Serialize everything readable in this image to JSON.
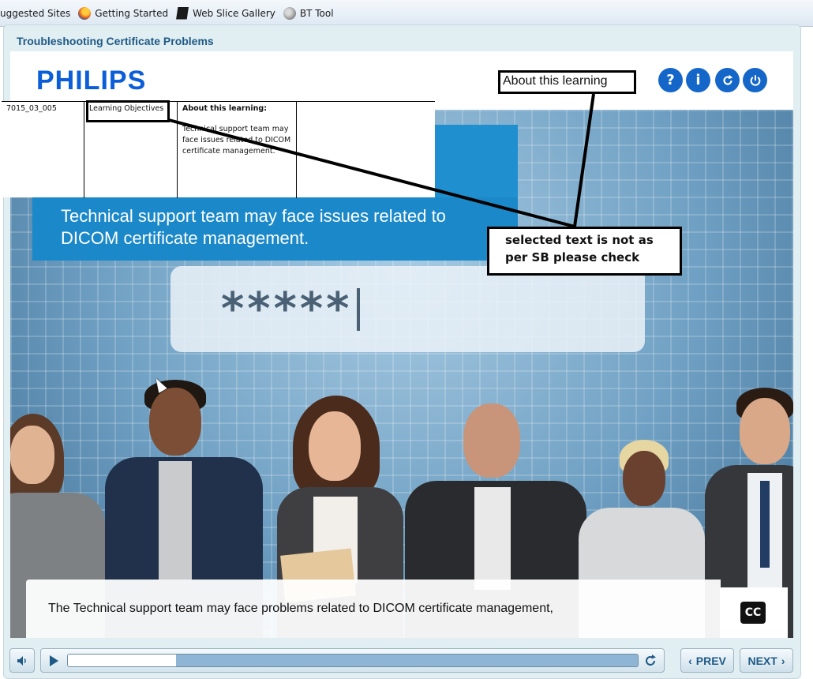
{
  "favorites_bar": {
    "items": [
      {
        "label": "uggested Sites",
        "icon": "ie-icon"
      },
      {
        "label": "Getting Started",
        "icon": "firefox-icon"
      },
      {
        "label": "Web Slice Gallery",
        "icon": "web-slice-icon"
      },
      {
        "label": "BT Tool",
        "icon": "globe-icon"
      }
    ]
  },
  "course": {
    "title": "Troubleshooting Certificate Problems",
    "logo": "PHILIPS",
    "header_buttons": [
      {
        "label": "?",
        "icon": "help-icon"
      },
      {
        "label": "i",
        "icon": "info-icon"
      },
      {
        "icon": "refresh-icon"
      },
      {
        "icon": "power-icon"
      }
    ]
  },
  "slide": {
    "banner_text": "Technical support team may face issues related to DICOM certificate management.",
    "password_text": "*****",
    "caption": "The Technical support team may face problems related to DICOM certificate management,",
    "cc_label": "CC"
  },
  "review_table": {
    "screen_id": "7015_03_005",
    "section": "Learning Objectives",
    "heading": "About this learning:",
    "body": "Technical support team may face issues related to DICOM certificate management."
  },
  "annotations": {
    "label": "About this learning",
    "note": "selected text is not as per SB please check"
  },
  "controls": {
    "progress": 0.19,
    "prev_label": "PREV",
    "next_label": "NEXT"
  },
  "colors": {
    "brand_blue": "#0b5ed7",
    "banner_blue": "#1a88c9",
    "button_blue": "#1466c9"
  }
}
